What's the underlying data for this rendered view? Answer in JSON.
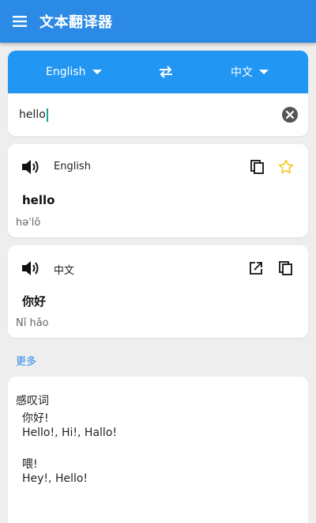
{
  "app_bar": {
    "title": "文本翻译器",
    "icon": "menu-icon"
  },
  "language_bar": {
    "source_lang": "English",
    "target_lang": "中文",
    "swap_icon": "swap-icon"
  },
  "input": {
    "value": "hello",
    "clear_icon": "clear-icon"
  },
  "source_card": {
    "language": "English",
    "text": "hello",
    "phonetic": "həˈlō",
    "icons": [
      "speaker-icon",
      "copy-icon",
      "star-icon"
    ]
  },
  "target_card": {
    "language": "中文",
    "text": "你好",
    "phonetic": "Nǐ hǎo",
    "icons": [
      "speaker-icon",
      "open-external-icon",
      "copy-icon"
    ]
  },
  "more_label": "更多",
  "definitions": {
    "category": "感叹词",
    "entries": [
      {
        "word": "你好!",
        "translations": "Hello!, Hi!, Hallo!"
      },
      {
        "word": "喂!",
        "translations": "Hey!, Hello!"
      }
    ]
  },
  "colors": {
    "app_bar": "#2a8ae6",
    "language_bar": "#2196f3",
    "link": "#2a8ae6",
    "star": "#f5c518",
    "background": "#eeeeee"
  }
}
